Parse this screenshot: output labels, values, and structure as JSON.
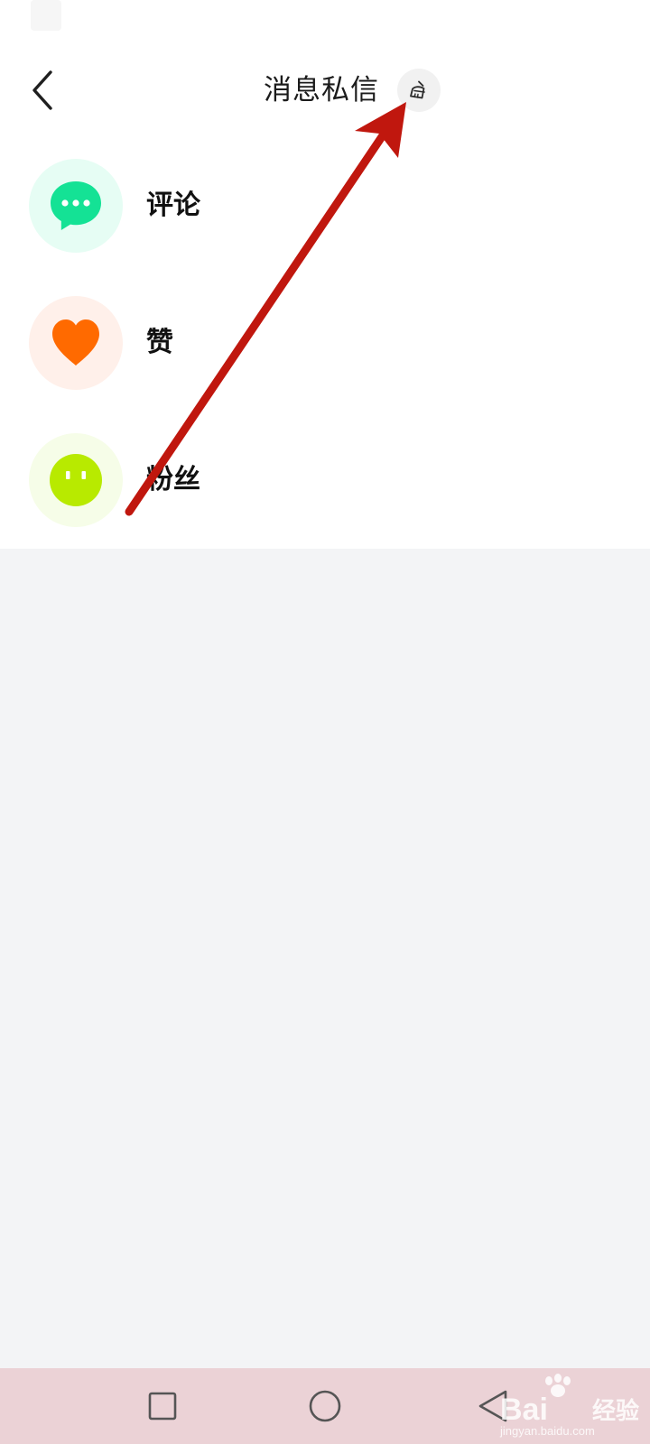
{
  "header": {
    "title": "消息私信",
    "back_icon": "chevron-left-icon",
    "clear_icon": "broom-icon"
  },
  "menu": {
    "items": [
      {
        "label": "评论",
        "icon": "comment-bubble-icon",
        "icon_color": "#14e295",
        "bg_color": "#e6fdf4"
      },
      {
        "label": "赞",
        "icon": "heart-icon",
        "icon_color": "#ff6a00",
        "bg_color": "#fff0ea"
      },
      {
        "label": "粉丝",
        "icon": "fan-face-icon",
        "icon_color": "#b8ea00",
        "bg_color": "#f6fde8"
      }
    ]
  },
  "navbar": {
    "recent_icon": "square-icon",
    "home_icon": "circle-icon",
    "back_icon": "triangle-back-icon"
  },
  "watermark": {
    "brand": "Bai",
    "suffix": "经验",
    "url": "jingyan.baidu.com"
  },
  "annotation": {
    "color": "#c0170e",
    "icon": "red-arrow-annotation"
  }
}
